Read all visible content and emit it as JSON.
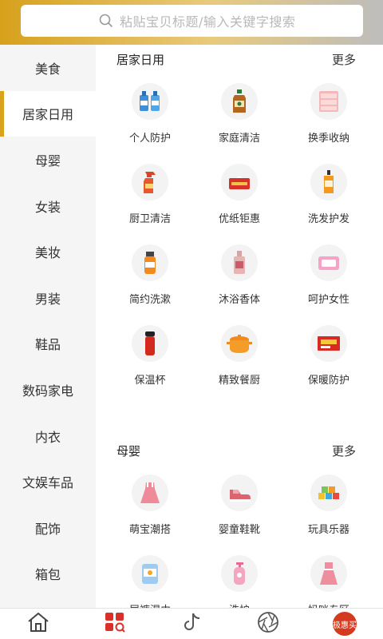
{
  "search": {
    "placeholder": "粘贴宝贝标题/输入关键字搜索",
    "icon": "search-icon"
  },
  "sidebar": {
    "active_color": "#d8a41f",
    "items": [
      {
        "label": "美食"
      },
      {
        "label": "居家日用"
      },
      {
        "label": "母婴"
      },
      {
        "label": "女装"
      },
      {
        "label": "美妆"
      },
      {
        "label": "男装"
      },
      {
        "label": "鞋品"
      },
      {
        "label": "数码家电"
      },
      {
        "label": "内衣"
      },
      {
        "label": "文娱车品"
      },
      {
        "label": "配饰"
      },
      {
        "label": "箱包"
      }
    ],
    "active_index": 1
  },
  "sections": [
    {
      "title": "居家日用",
      "more": "更多",
      "items": [
        {
          "label": "个人防护",
          "icon": "sanitizer-bottles-icon"
        },
        {
          "label": "家庭清洁",
          "icon": "disinfectant-bottle-icon"
        },
        {
          "label": "换季收纳",
          "icon": "storage-drawers-icon"
        },
        {
          "label": "厨卫清洁",
          "icon": "spray-bottle-icon"
        },
        {
          "label": "优纸钜惠",
          "icon": "tissue-box-icon"
        },
        {
          "label": "洗发护发",
          "icon": "shampoo-bottle-icon"
        },
        {
          "label": "简约洗漱",
          "icon": "mouthwash-icon"
        },
        {
          "label": "沐浴香体",
          "icon": "body-spray-icon"
        },
        {
          "label": "呵护女性",
          "icon": "sanitary-pad-icon"
        },
        {
          "label": "保温杯",
          "icon": "thermos-icon"
        },
        {
          "label": "精致餐厨",
          "icon": "cooking-pot-icon"
        },
        {
          "label": "保暖防护",
          "icon": "warmer-pack-icon"
        }
      ]
    },
    {
      "title": "母婴",
      "more": "更多",
      "items": [
        {
          "label": "萌宝潮搭",
          "icon": "baby-dress-icon"
        },
        {
          "label": "婴童鞋靴",
          "icon": "baby-shoe-icon"
        },
        {
          "label": "玩具乐器",
          "icon": "toy-blocks-icon"
        },
        {
          "label": "尿裤湿巾",
          "icon": "diaper-pack-icon"
        },
        {
          "label": "洗护",
          "icon": "baby-wash-icon"
        },
        {
          "label": "妈咪专区",
          "icon": "maternity-dress-icon"
        }
      ]
    }
  ],
  "tabbar": {
    "items": [
      {
        "name": "home-icon"
      },
      {
        "name": "category-icon"
      },
      {
        "name": "douyin-icon"
      },
      {
        "name": "aperture-icon"
      },
      {
        "name": "brand-logo",
        "label": "极惠买"
      }
    ],
    "active_color": "#d9302a"
  }
}
